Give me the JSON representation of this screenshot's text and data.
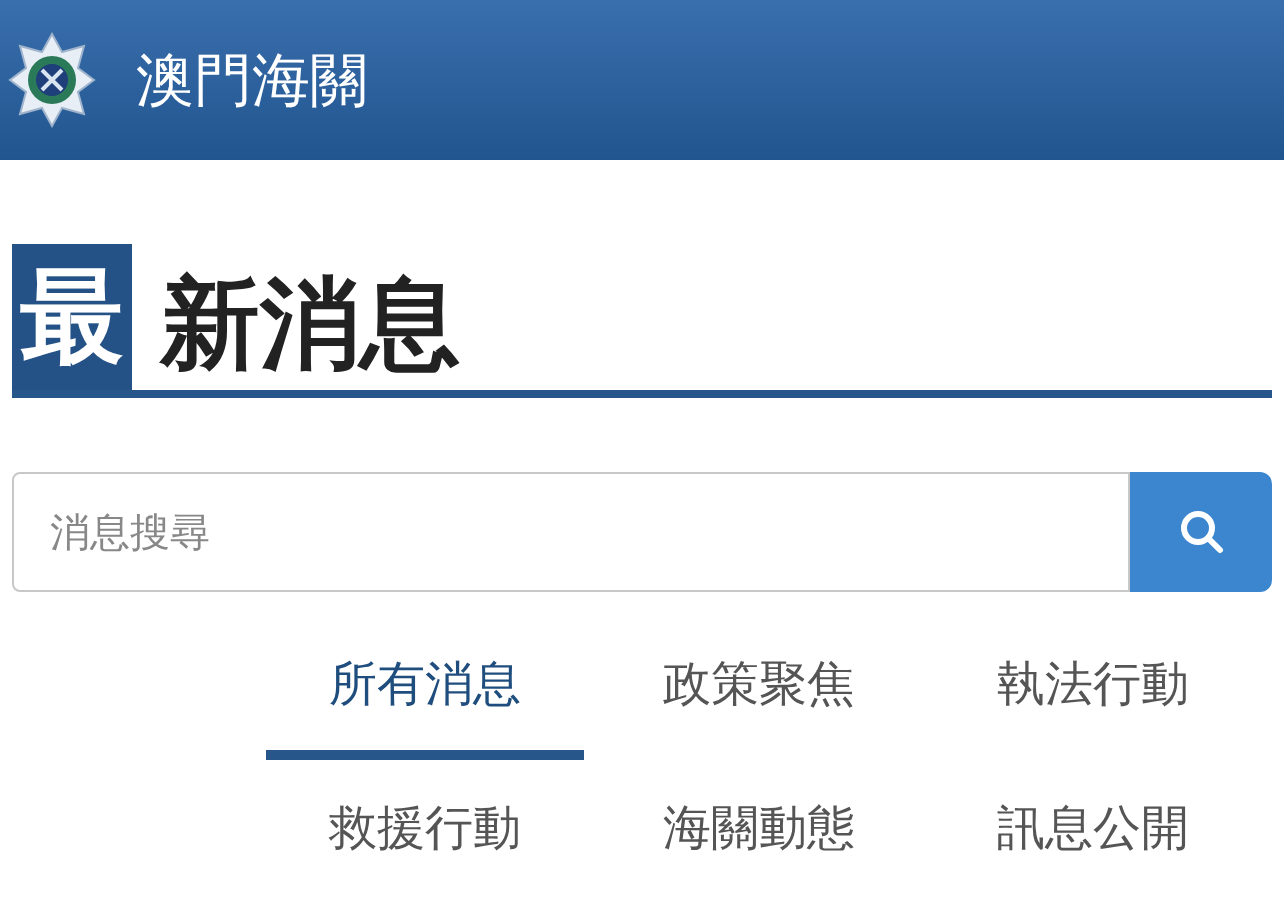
{
  "header": {
    "title": "澳門海關"
  },
  "heading": {
    "lead": "最",
    "rest": "新消息"
  },
  "search": {
    "placeholder": "消息搜尋"
  },
  "tabs": [
    {
      "label": "所有消息",
      "selected": true
    },
    {
      "label": "政策聚焦",
      "selected": false
    },
    {
      "label": "執法行動",
      "selected": false
    },
    {
      "label": "救援行動",
      "selected": false
    },
    {
      "label": "海關動態",
      "selected": false
    },
    {
      "label": "訊息公開",
      "selected": false
    }
  ]
}
